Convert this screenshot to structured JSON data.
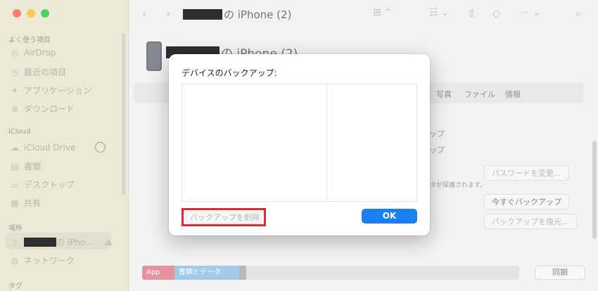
{
  "window": {
    "title_suffix": "の iPhone (2)",
    "traffic_colors": [
      "#ff5f57",
      "#febc2e",
      "#28c840"
    ]
  },
  "sidebar": {
    "sections": [
      "よく使う項目",
      "iCloud",
      "場所",
      "タグ"
    ],
    "favorites": [
      {
        "label": "AirDrop",
        "icon": "airdrop-icon"
      },
      {
        "label": "最近の項目",
        "icon": "clock-icon"
      },
      {
        "label": "アプリケーション",
        "icon": "applications-icon"
      },
      {
        "label": "ダウンロード",
        "icon": "download-icon"
      }
    ],
    "icloud": [
      {
        "label": "iCloud Drive",
        "icon": "cloud-icon"
      },
      {
        "label": "書類",
        "icon": "document-icon"
      },
      {
        "label": "デスクトップ",
        "icon": "desktop-icon"
      },
      {
        "label": "共有",
        "icon": "shared-folder-icon"
      }
    ],
    "locations": [
      {
        "label": "の iPho...",
        "icon": "phone-icon"
      },
      {
        "label": "ネットワーク",
        "icon": "network-icon"
      }
    ]
  },
  "content": {
    "device_title_suffix": "の iPhone (2)",
    "tabs": [
      "写真",
      "ファイル",
      "情報"
    ],
    "bg_lines": [
      "ップ",
      "ップ",
      "ータが保護されます。"
    ],
    "buttons": {
      "change_password": "パスワードを変更...",
      "backup_now": "今すぐバックアップ",
      "restore_backup": "バックアップを復元..."
    },
    "storage": {
      "segments": [
        "App",
        "書類とデータ",
        ""
      ]
    },
    "sync_label": "同期"
  },
  "dialog": {
    "title": "デバイスのバックアップ:",
    "delete_label": "バックアップを削除",
    "ok_label": "OK"
  }
}
